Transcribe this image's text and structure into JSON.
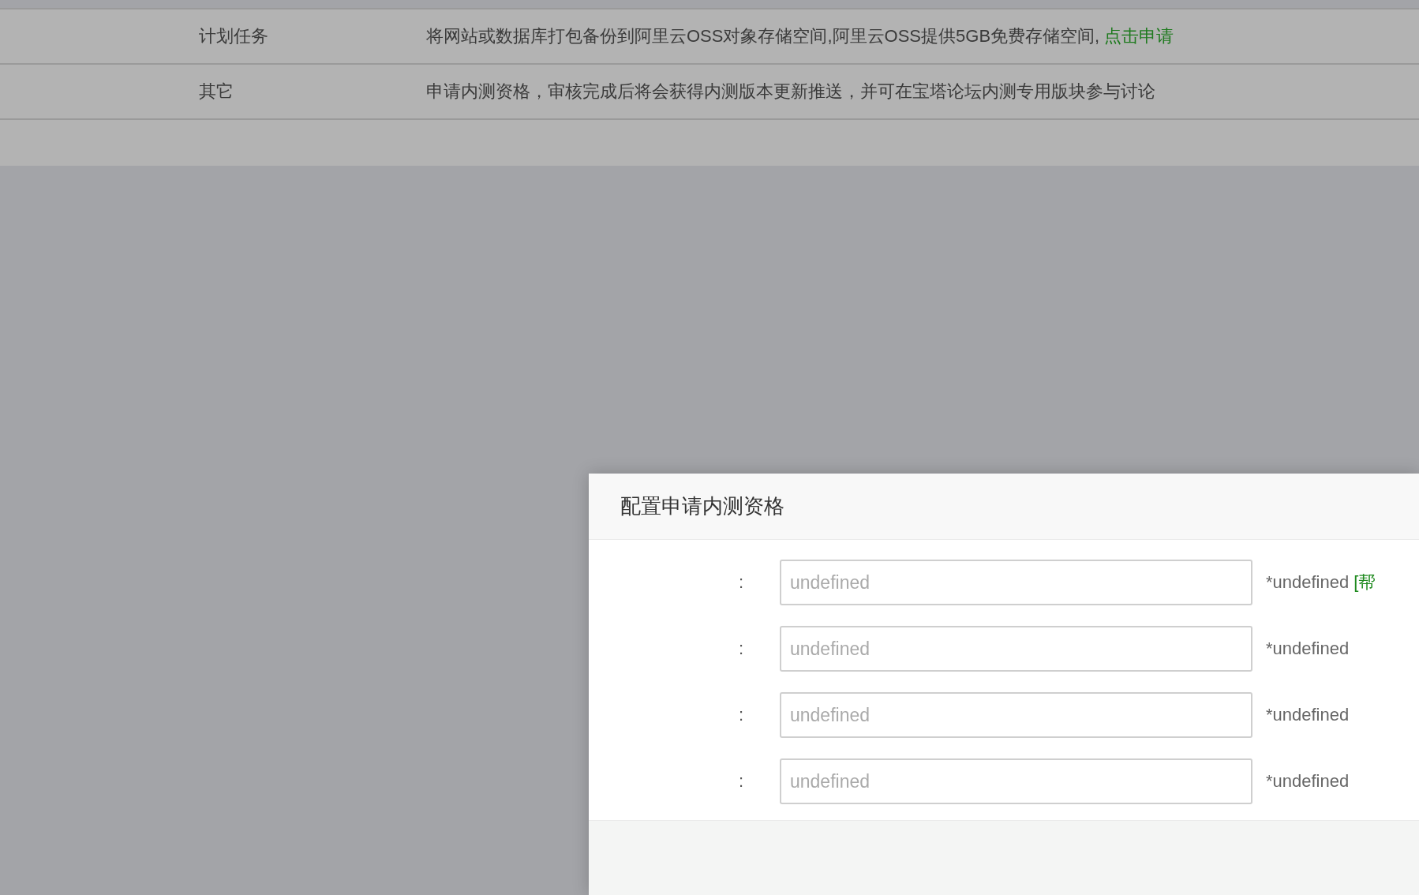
{
  "settings_table": {
    "rows": [
      {
        "name": "计划任务",
        "description": "将网站或数据库打包备份到阿里云OSS对象存储空间,阿里云OSS提供5GB免费存储空间,",
        "link": "点击申请"
      },
      {
        "name": "其它",
        "description": "申请内测资格，审核完成后将会获得内测版本更新推送，并可在宝塔论坛内测专用版块参与讨论"
      }
    ]
  },
  "dialog": {
    "title": "配置申请内测资格",
    "fields": [
      {
        "label": ":",
        "placeholder": "undefined",
        "note": "*undefined",
        "help_link": "[帮"
      },
      {
        "label": ":",
        "placeholder": "undefined",
        "note": "*undefined"
      },
      {
        "label": ":",
        "placeholder": "undefined",
        "note": "*undefined"
      },
      {
        "label": ":",
        "placeholder": "undefined",
        "note": "*undefined"
      }
    ]
  }
}
